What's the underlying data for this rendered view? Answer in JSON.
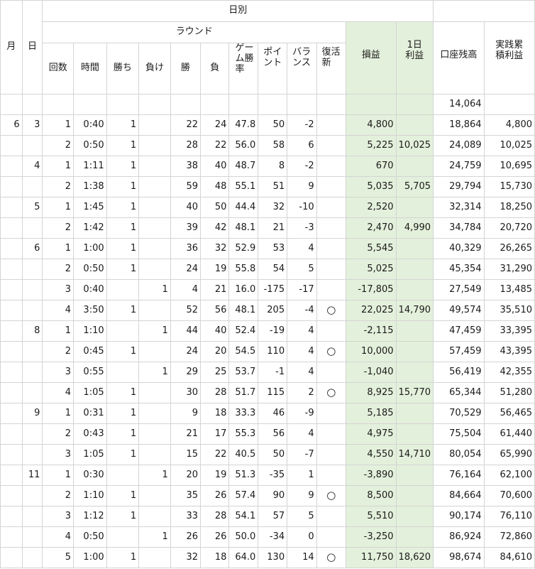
{
  "header": {
    "month": "月",
    "day": "日",
    "daily": "日別",
    "round": "ラウンド",
    "count": "回数",
    "time": "時間",
    "win": "勝ち",
    "lose": "負け",
    "win_k": "勝",
    "lose_k": "負",
    "game_rate": "ゲーム勝率",
    "point": "ポイント",
    "balance": "バランス",
    "revival": "復活新",
    "pnl": "損益",
    "day_profit": "1日利益",
    "account": "口座残高",
    "cum_profit": "実践累積利益"
  },
  "initial_balance": "14,064",
  "rows": [
    {
      "month": "6",
      "day": "3",
      "n": "1",
      "time": "0:40",
      "w": "1",
      "l": "",
      "wins": "22",
      "losses": "24",
      "rate": "47.8",
      "pt": "50",
      "bal": "-2",
      "rev": "",
      "pnl": "4,800",
      "dp": "",
      "acct": "18,864",
      "cum": "4,800"
    },
    {
      "month": "",
      "day": "",
      "n": "2",
      "time": "0:50",
      "w": "1",
      "l": "",
      "wins": "28",
      "losses": "22",
      "rate": "56.0",
      "pt": "58",
      "bal": "6",
      "rev": "",
      "pnl": "5,225",
      "dp": "10,025",
      "acct": "24,089",
      "cum": "10,025"
    },
    {
      "month": "",
      "day": "4",
      "n": "1",
      "time": "1:11",
      "w": "1",
      "l": "",
      "wins": "38",
      "losses": "40",
      "rate": "48.7",
      "pt": "8",
      "bal": "-2",
      "rev": "",
      "pnl": "670",
      "dp": "",
      "acct": "24,759",
      "cum": "10,695"
    },
    {
      "month": "",
      "day": "",
      "n": "2",
      "time": "1:38",
      "w": "1",
      "l": "",
      "wins": "59",
      "losses": "48",
      "rate": "55.1",
      "pt": "51",
      "bal": "9",
      "rev": "",
      "pnl": "5,035",
      "dp": "5,705",
      "acct": "29,794",
      "cum": "15,730"
    },
    {
      "month": "",
      "day": "5",
      "n": "1",
      "time": "1:45",
      "w": "1",
      "l": "",
      "wins": "40",
      "losses": "50",
      "rate": "44.4",
      "pt": "32",
      "bal": "-10",
      "rev": "",
      "pnl": "2,520",
      "dp": "",
      "acct": "32,314",
      "cum": "18,250"
    },
    {
      "month": "",
      "day": "",
      "n": "2",
      "time": "1:42",
      "w": "1",
      "l": "",
      "wins": "39",
      "losses": "42",
      "rate": "48.1",
      "pt": "21",
      "bal": "-3",
      "rev": "",
      "pnl": "2,470",
      "dp": "4,990",
      "acct": "34,784",
      "cum": "20,720"
    },
    {
      "month": "",
      "day": "6",
      "n": "1",
      "time": "1:00",
      "w": "1",
      "l": "",
      "wins": "36",
      "losses": "32",
      "rate": "52.9",
      "pt": "53",
      "bal": "4",
      "rev": "",
      "pnl": "5,545",
      "dp": "",
      "acct": "40,329",
      "cum": "26,265"
    },
    {
      "month": "",
      "day": "",
      "n": "2",
      "time": "0:50",
      "w": "1",
      "l": "",
      "wins": "24",
      "losses": "19",
      "rate": "55.8",
      "pt": "54",
      "bal": "5",
      "rev": "",
      "pnl": "5,025",
      "dp": "",
      "acct": "45,354",
      "cum": "31,290"
    },
    {
      "month": "",
      "day": "",
      "n": "3",
      "time": "0:40",
      "w": "",
      "l": "1",
      "wins": "4",
      "losses": "21",
      "rate": "16.0",
      "pt": "-175",
      "bal": "-17",
      "rev": "",
      "pnl": "-17,805",
      "dp": "",
      "acct": "27,549",
      "cum": "13,485"
    },
    {
      "month": "",
      "day": "",
      "n": "4",
      "time": "3:50",
      "w": "1",
      "l": "",
      "wins": "52",
      "losses": "56",
      "rate": "48.1",
      "pt": "205",
      "bal": "-4",
      "rev": "○",
      "pnl": "22,025",
      "dp": "14,790",
      "acct": "49,574",
      "cum": "35,510"
    },
    {
      "month": "",
      "day": "8",
      "n": "1",
      "time": "1:10",
      "w": "",
      "l": "1",
      "wins": "44",
      "losses": "40",
      "rate": "52.4",
      "pt": "-19",
      "bal": "4",
      "rev": "",
      "pnl": "-2,115",
      "dp": "",
      "acct": "47,459",
      "cum": "33,395"
    },
    {
      "month": "",
      "day": "",
      "n": "2",
      "time": "0:45",
      "w": "1",
      "l": "",
      "wins": "24",
      "losses": "20",
      "rate": "54.5",
      "pt": "110",
      "bal": "4",
      "rev": "○",
      "pnl": "10,000",
      "dp": "",
      "acct": "57,459",
      "cum": "43,395"
    },
    {
      "month": "",
      "day": "",
      "n": "3",
      "time": "0:55",
      "w": "",
      "l": "1",
      "wins": "29",
      "losses": "25",
      "rate": "53.7",
      "pt": "-1",
      "bal": "4",
      "rev": "",
      "pnl": "-1,040",
      "dp": "",
      "acct": "56,419",
      "cum": "42,355"
    },
    {
      "month": "",
      "day": "",
      "n": "4",
      "time": "1:05",
      "w": "1",
      "l": "",
      "wins": "30",
      "losses": "28",
      "rate": "51.7",
      "pt": "115",
      "bal": "2",
      "rev": "○",
      "pnl": "8,925",
      "dp": "15,770",
      "acct": "65,344",
      "cum": "51,280"
    },
    {
      "month": "",
      "day": "9",
      "n": "1",
      "time": "0:31",
      "w": "1",
      "l": "",
      "wins": "9",
      "losses": "18",
      "rate": "33.3",
      "pt": "46",
      "bal": "-9",
      "rev": "",
      "pnl": "5,185",
      "dp": "",
      "acct": "70,529",
      "cum": "56,465"
    },
    {
      "month": "",
      "day": "",
      "n": "2",
      "time": "0:43",
      "w": "1",
      "l": "",
      "wins": "21",
      "losses": "17",
      "rate": "55.3",
      "pt": "56",
      "bal": "4",
      "rev": "",
      "pnl": "4,975",
      "dp": "",
      "acct": "75,504",
      "cum": "61,440"
    },
    {
      "month": "",
      "day": "",
      "n": "3",
      "time": "1:05",
      "w": "1",
      "l": "",
      "wins": "15",
      "losses": "22",
      "rate": "40.5",
      "pt": "50",
      "bal": "-7",
      "rev": "",
      "pnl": "4,550",
      "dp": "14,710",
      "acct": "80,054",
      "cum": "65,990"
    },
    {
      "month": "",
      "day": "11",
      "n": "1",
      "time": "0:30",
      "w": "",
      "l": "1",
      "wins": "20",
      "losses": "19",
      "rate": "51.3",
      "pt": "-35",
      "bal": "1",
      "rev": "",
      "pnl": "-3,890",
      "dp": "",
      "acct": "76,164",
      "cum": "62,100"
    },
    {
      "month": "",
      "day": "",
      "n": "2",
      "time": "1:10",
      "w": "1",
      "l": "",
      "wins": "35",
      "losses": "26",
      "rate": "57.4",
      "pt": "90",
      "bal": "9",
      "rev": "○",
      "pnl": "8,500",
      "dp": "",
      "acct": "84,664",
      "cum": "70,600"
    },
    {
      "month": "",
      "day": "",
      "n": "3",
      "time": "1:12",
      "w": "1",
      "l": "",
      "wins": "33",
      "losses": "28",
      "rate": "54.1",
      "pt": "57",
      "bal": "5",
      "rev": "",
      "pnl": "5,510",
      "dp": "",
      "acct": "90,174",
      "cum": "76,110"
    },
    {
      "month": "",
      "day": "",
      "n": "4",
      "time": "0:50",
      "w": "",
      "l": "1",
      "wins": "26",
      "losses": "26",
      "rate": "50.0",
      "pt": "-34",
      "bal": "0",
      "rev": "",
      "pnl": "-3,250",
      "dp": "",
      "acct": "86,924",
      "cum": "72,860"
    },
    {
      "month": "",
      "day": "",
      "n": "5",
      "time": "1:00",
      "w": "1",
      "l": "",
      "wins": "32",
      "losses": "18",
      "rate": "64.0",
      "pt": "130",
      "bal": "14",
      "rev": "○",
      "pnl": "11,750",
      "dp": "18,620",
      "acct": "98,674",
      "cum": "84,610"
    }
  ]
}
